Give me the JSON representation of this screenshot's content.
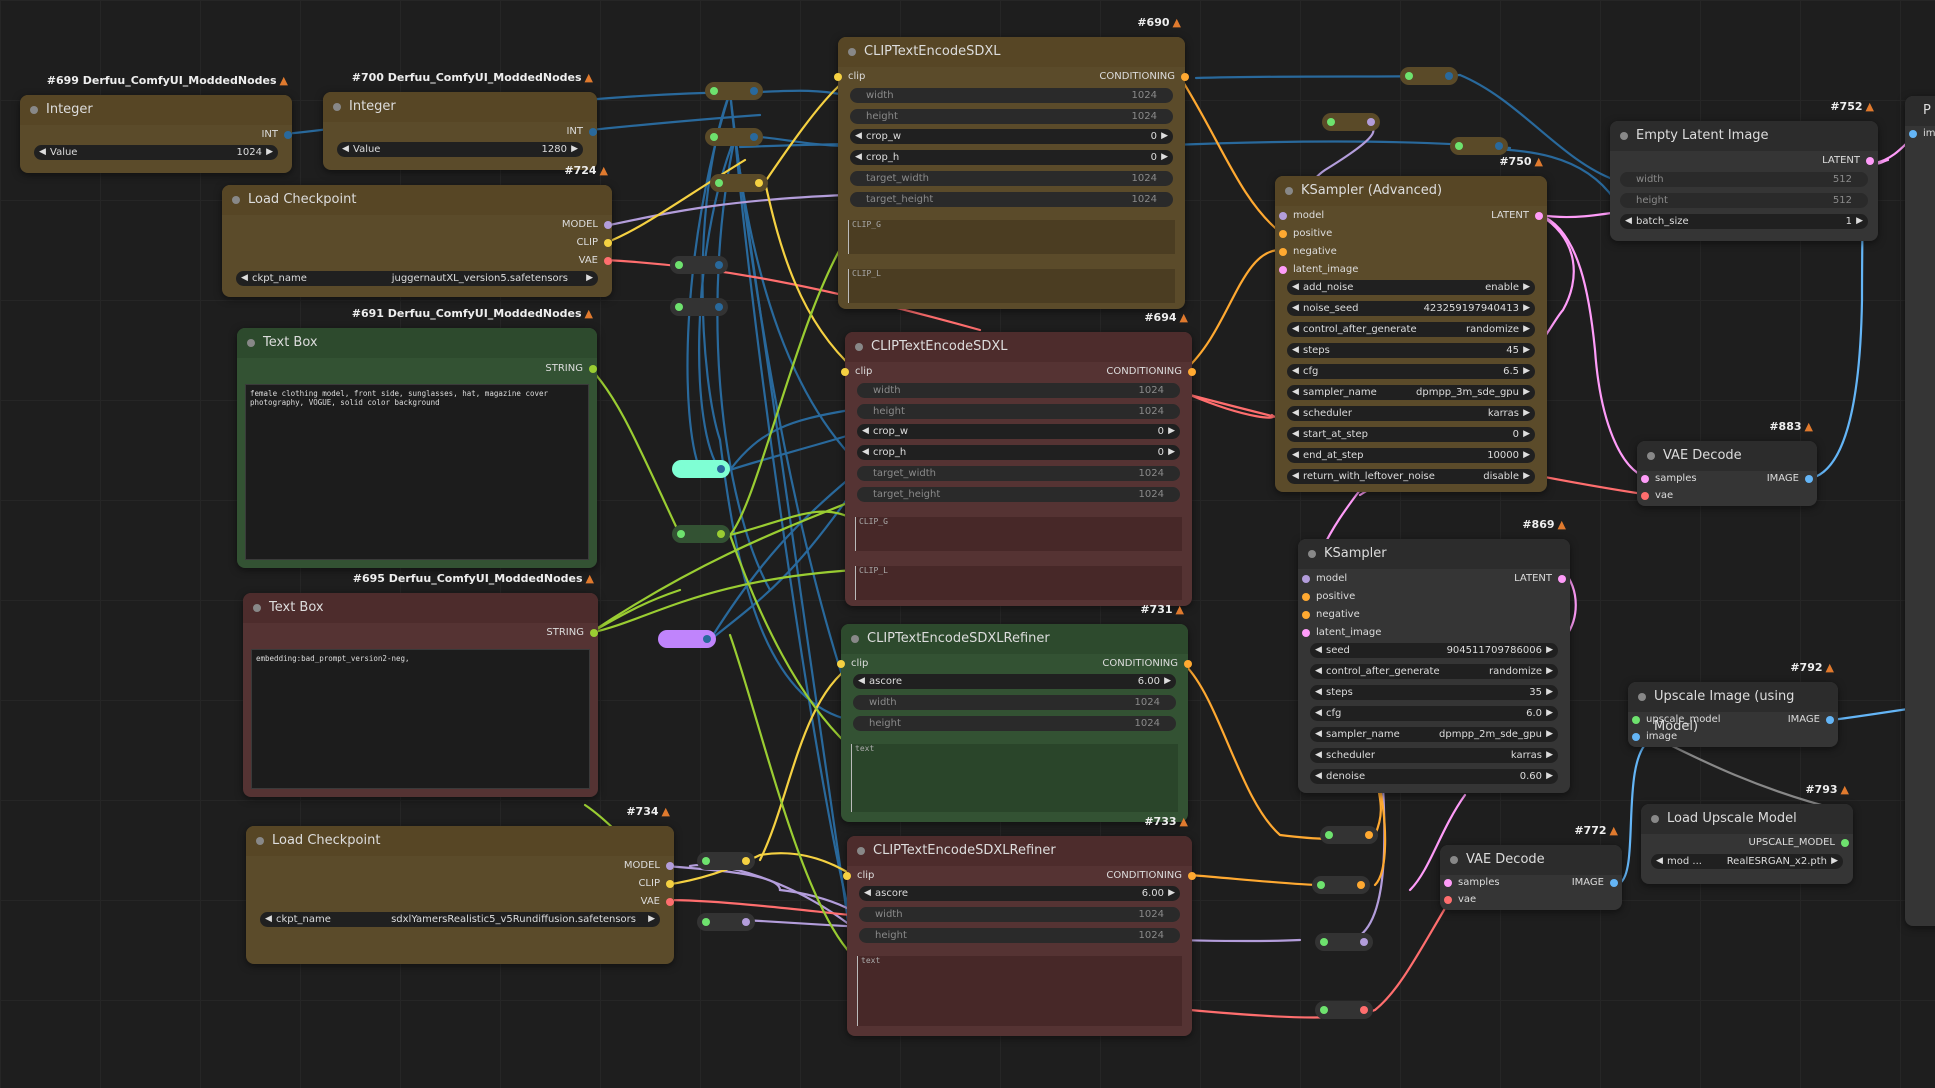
{
  "colors": {
    "clip": "#f5d142",
    "model": "#b39ddb",
    "vae": "#ff6e6e",
    "latent": "#ff9cf9",
    "conditioning": "#ffa931",
    "int": "#29699c",
    "string": "#9acd32",
    "image": "#64b5f6",
    "upscale_model": "#6ee26e"
  },
  "nodes": {
    "int699": {
      "badge": "#699 Derfuu_ComfyUI_ModdedNodes",
      "title": "Integer",
      "out": "INT",
      "w_label": "Value",
      "w_value": "1024"
    },
    "int700": {
      "badge": "#700 Derfuu_ComfyUI_ModdedNodes",
      "title": "Integer",
      "out": "INT",
      "w_label": "Value",
      "w_value": "1280"
    },
    "ckpt724": {
      "badge": "#724",
      "title": "Load Checkpoint",
      "o1": "MODEL",
      "o2": "CLIP",
      "o3": "VAE",
      "w_label": "ckpt_name",
      "w_value": "juggernautXL_version5.safetensors"
    },
    "text691": {
      "badge": "#691 Derfuu_ComfyUI_ModdedNodes",
      "title": "Text Box",
      "out": "STRING",
      "text": "female clothing model, front side, sunglasses, hat, magazine cover photography, VOGUE, solid color background"
    },
    "text695": {
      "badge": "#695 Derfuu_ComfyUI_ModdedNodes",
      "title": "Text Box",
      "out": "STRING",
      "text": "embedding:bad_prompt_version2-neg,"
    },
    "ckpt734": {
      "badge": "#734",
      "title": "Load Checkpoint",
      "o1": "MODEL",
      "o2": "CLIP",
      "o3": "VAE",
      "w_label": "ckpt_name",
      "w_value": "sdxlYamersRealistic5_v5Rundiffusion.safetensors"
    },
    "clip690": {
      "badge": "#690",
      "title": "CLIPTextEncodeSDXL",
      "in": "clip",
      "out": "CONDITIONING",
      "width": "1024",
      "height": "1024",
      "crop_w": "0",
      "crop_h": "0",
      "target_width": "1024",
      "target_height": "1024",
      "l1": "width",
      "l2": "height",
      "l3": "crop_w",
      "l4": "crop_h",
      "l5": "target_width",
      "l6": "target_height",
      "t1": "CLIP_G",
      "t2": "CLIP_L"
    },
    "clip694": {
      "badge": "#694",
      "title": "CLIPTextEncodeSDXL",
      "in": "clip",
      "out": "CONDITIONING",
      "width": "1024",
      "height": "1024",
      "crop_w": "0",
      "crop_h": "0",
      "target_width": "1024",
      "target_height": "1024",
      "l1": "width",
      "l2": "height",
      "l3": "crop_w",
      "l4": "crop_h",
      "l5": "target_width",
      "l6": "target_height",
      "t1": "CLIP_G",
      "t2": "CLIP_L"
    },
    "ref731": {
      "badge": "#731",
      "title": "CLIPTextEncodeSDXLRefiner",
      "in": "clip",
      "out": "CONDITIONING",
      "l1": "ascore",
      "ascore": "6.00",
      "l2": "width",
      "width": "1024",
      "l3": "height",
      "height": "1024",
      "t1": "text"
    },
    "ref733": {
      "badge": "#733",
      "title": "CLIPTextEncodeSDXLRefiner",
      "in": "clip",
      "out": "CONDITIONING",
      "l1": "ascore",
      "ascore": "6.00",
      "l2": "width",
      "width": "1024",
      "l3": "height",
      "height": "1024",
      "t1": "text"
    },
    "ks750": {
      "badge": "#750",
      "title": "KSampler (Advanced)",
      "i1": "model",
      "i2": "positive",
      "i3": "negative",
      "i4": "latent_image",
      "out": "LATENT",
      "widgets": [
        [
          "add_noise",
          "enable"
        ],
        [
          "noise_seed",
          "423259197940413"
        ],
        [
          "control_after_generate",
          "randomize"
        ],
        [
          "steps",
          "45"
        ],
        [
          "cfg",
          "6.5"
        ],
        [
          "sampler_name",
          "dpmpp_3m_sde_gpu"
        ],
        [
          "scheduler",
          "karras"
        ],
        [
          "start_at_step",
          "0"
        ],
        [
          "end_at_step",
          "10000"
        ],
        [
          "return_with_leftover_noise",
          "disable"
        ]
      ]
    },
    "ks869": {
      "badge": "#869",
      "title": "KSampler",
      "i1": "model",
      "i2": "positive",
      "i3": "negative",
      "i4": "latent_image",
      "out": "LATENT",
      "widgets": [
        [
          "seed",
          "904511709786006"
        ],
        [
          "control_after_generate",
          "randomize"
        ],
        [
          "steps",
          "35"
        ],
        [
          "cfg",
          "6.0"
        ],
        [
          "sampler_name",
          "dpmpp_2m_sde_gpu"
        ],
        [
          "scheduler",
          "karras"
        ],
        [
          "denoise",
          "0.60"
        ]
      ]
    },
    "lat752": {
      "badge": "#752",
      "title": "Empty Latent Image",
      "out": "LATENT",
      "l1": "width",
      "v1": "512",
      "l2": "height",
      "v2": "512",
      "l3": "batch_size",
      "v3": "1"
    },
    "vae883": {
      "badge": "#883",
      "title": "VAE Decode",
      "i1": "samples",
      "i2": "vae",
      "out": "IMAGE"
    },
    "vae772": {
      "badge": "#772",
      "title": "VAE Decode",
      "i1": "samples",
      "i2": "vae",
      "out": "IMAGE"
    },
    "up792": {
      "badge": "#792",
      "title": "Upscale Image (using Model)",
      "i1": "upscale_model",
      "i2": "image",
      "out": "IMAGE"
    },
    "lum793": {
      "badge": "#793",
      "title": "Load Upscale Model",
      "out": "UPSCALE_MODEL",
      "w_label": "mod ...",
      "w_value": "RealESRGAN_x2.pth"
    },
    "edge": {
      "title": "P",
      "in": "ima"
    }
  }
}
